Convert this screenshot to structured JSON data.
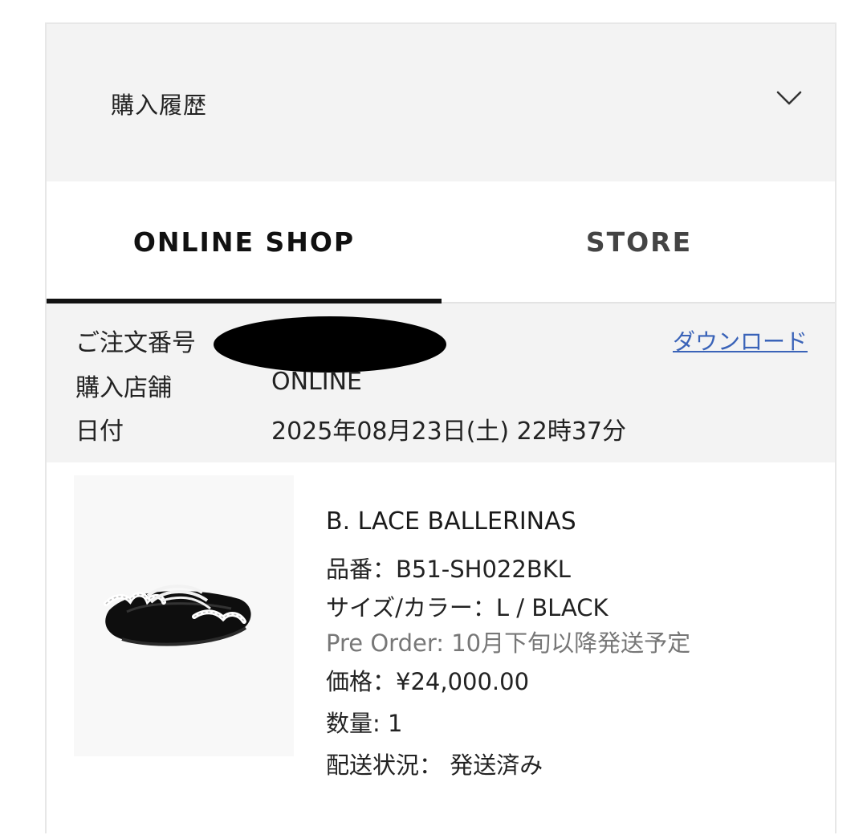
{
  "accordion": {
    "title": "購入履歴",
    "icon": "chevron-down-icon"
  },
  "tabs": [
    {
      "label": "ONLINE SHOP",
      "active": true
    },
    {
      "label": "STORE",
      "active": false
    }
  ],
  "order": {
    "order_number_label": "ご注文番号",
    "download_label": "ダウンロード",
    "store_label": "購入店舗",
    "store_value": "ONLINE",
    "date_label": "日付",
    "date_value": "2025年08月23日(土) 22時37分"
  },
  "product": {
    "name": "B. LACE BALLERINAS",
    "item_number": "品番：B51-SH022BKL",
    "size_color": "サイズ/カラー：L / BLACK",
    "pre_order": "Pre Order: 10月下旬以降発送予定",
    "price": "価格：¥24,000.00",
    "quantity": "数量: 1",
    "shipping_status": "配送状況： 発送済み"
  },
  "colors": {
    "accent_link": "#3a63b8",
    "tab_active_underline": "#111111",
    "section_bg": "#f3f3f3"
  }
}
